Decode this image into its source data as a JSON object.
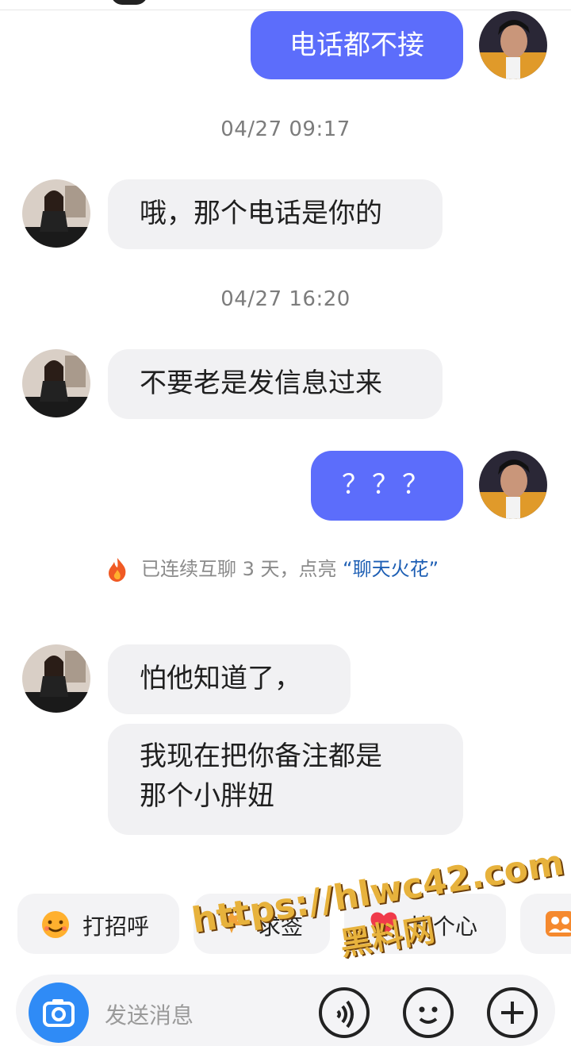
{
  "messages": {
    "m1": "电话都不接",
    "ts1": "04/27 09:17",
    "m2": "哦，那个电话是你的",
    "ts2": "04/27 16:20",
    "m3": "不要老是发信息过来",
    "m4": "？？？",
    "spark_prefix": "已连续互聊 3 天，点亮",
    "spark_link": "“聊天火花”",
    "m5": "怕他知道了，",
    "m6_line1": "我现在把你备注都是",
    "m6_line2": "那个小胖妞"
  },
  "quick_actions": [
    {
      "label": "打招呼",
      "icon": "smile-face-icon"
    },
    {
      "label": "求签",
      "icon": "fortune-icon"
    },
    {
      "label": "比个心",
      "icon": "heart-icon"
    },
    {
      "label": "",
      "icon": "group-icon"
    }
  ],
  "composer": {
    "placeholder": "发送消息"
  },
  "watermark": {
    "line1": "https://hlwc42.com",
    "line2": "黑料网"
  },
  "colors": {
    "my_bubble": "#5c6dfb",
    "their_bubble": "#f1f1f3",
    "link": "#1e5fb4"
  }
}
